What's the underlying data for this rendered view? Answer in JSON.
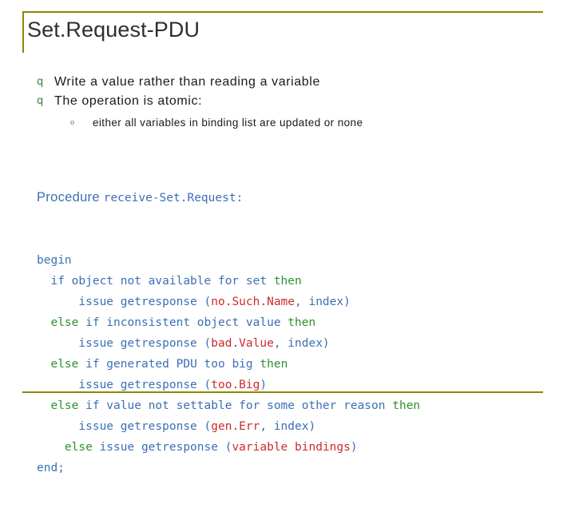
{
  "slide": {
    "title": "Set.Request-PDU",
    "bullet_marker": "q",
    "sub_marker": "o",
    "bullets": [
      {
        "text": "Write a value rather than reading a variable"
      },
      {
        "text": "The operation is atomic:"
      }
    ],
    "subbullets": [
      {
        "text": "either all variables in binding list are updated or none"
      }
    ],
    "procedure": {
      "keyword": "Procedure",
      "name": "receive-Set.Request:"
    },
    "code_lines": [
      [
        {
          "t": "begin",
          "c": "blue"
        }
      ],
      [
        {
          "t": "  if object not available for set ",
          "c": "blue"
        },
        {
          "t": "then",
          "c": "kw"
        }
      ],
      [
        {
          "t": "      issue getresponse (",
          "c": "blue"
        },
        {
          "t": "no.Such.Name",
          "c": "err"
        },
        {
          "t": ", index)",
          "c": "blue"
        }
      ],
      [
        {
          "t": "  ",
          "c": "blue"
        },
        {
          "t": "else",
          "c": "kw"
        },
        {
          "t": " if inconsistent object value ",
          "c": "blue"
        },
        {
          "t": "then",
          "c": "kw"
        }
      ],
      [
        {
          "t": "      issue getresponse (",
          "c": "blue"
        },
        {
          "t": "bad.Value",
          "c": "err"
        },
        {
          "t": ", index)",
          "c": "blue"
        }
      ],
      [
        {
          "t": "  ",
          "c": "blue"
        },
        {
          "t": "else",
          "c": "kw"
        },
        {
          "t": " if generated PDU too big ",
          "c": "blue"
        },
        {
          "t": "then",
          "c": "kw"
        }
      ],
      [
        {
          "t": "      issue getresponse (",
          "c": "blue"
        },
        {
          "t": "too.Big",
          "c": "err"
        },
        {
          "t": ")",
          "c": "blue"
        }
      ],
      [
        {
          "t": "  ",
          "c": "blue"
        },
        {
          "t": "else",
          "c": "kw"
        },
        {
          "t": " if value not settable for some other reason ",
          "c": "blue"
        },
        {
          "t": "then",
          "c": "kw"
        }
      ],
      [
        {
          "t": "      issue getresponse (",
          "c": "blue"
        },
        {
          "t": "gen.Err",
          "c": "err"
        },
        {
          "t": ", index)",
          "c": "blue"
        }
      ],
      [
        {
          "t": "    ",
          "c": "blue"
        },
        {
          "t": "else",
          "c": "kw"
        },
        {
          "t": " issue getresponse (",
          "c": "blue"
        },
        {
          "t": "variable bindings",
          "c": "err"
        },
        {
          "t": ")",
          "c": "blue"
        }
      ],
      [
        {
          "t": "end;",
          "c": "blue"
        }
      ]
    ]
  },
  "colors": {
    "rule": "#8a8a00",
    "title": "#2f2f2f",
    "bullet_marker": "#3b7d3b",
    "code_blue": "#3b6fb5",
    "code_green": "#2f8f2f",
    "code_red": "#cc2b2b"
  }
}
